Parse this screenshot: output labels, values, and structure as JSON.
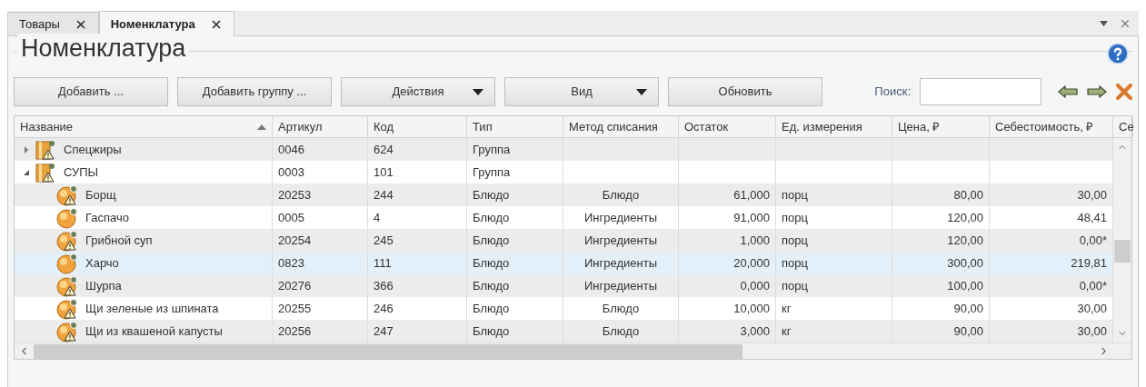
{
  "tabs": [
    {
      "label": "Товары",
      "selected": false
    },
    {
      "label": "Номенклатура",
      "selected": true
    }
  ],
  "panel": {
    "title": "Номенклатура"
  },
  "toolbar": {
    "buttons": [
      {
        "label": "Добавить ...",
        "kind": "plain"
      },
      {
        "label": "Добавить группу ...",
        "kind": "plain"
      },
      {
        "label": "Действия",
        "kind": "dropdown"
      },
      {
        "label": "Вид",
        "kind": "dropdown"
      },
      {
        "label": "Обновить",
        "kind": "plain"
      }
    ],
    "search_label": "Поиск:"
  },
  "table": {
    "columns": [
      {
        "label": "Название",
        "kind": "tree",
        "sorted": true
      },
      {
        "label": "Артикул",
        "kind": "text",
        "sorted": false
      },
      {
        "label": "Код",
        "kind": "text",
        "sorted": false
      },
      {
        "label": "Тип",
        "kind": "text",
        "sorted": false
      },
      {
        "label": "Метод списания",
        "kind": "centered",
        "sorted": false
      },
      {
        "label": "Остаток",
        "kind": "number",
        "sorted": false
      },
      {
        "label": "Ед. измерения",
        "kind": "text",
        "sorted": false
      },
      {
        "label": "Цена, ₽",
        "kind": "number",
        "sorted": false
      },
      {
        "label": "Себестоимость, ₽",
        "kind": "number",
        "sorted": false
      },
      {
        "label": "Се",
        "sorted": false
      }
    ],
    "rows": [
      {
        "kind": "group",
        "warning": true,
        "expanded": false,
        "selected": false,
        "cells": [
          "Спецжиры",
          "0046",
          "624",
          "Группа",
          "",
          "",
          "",
          "",
          ""
        ]
      },
      {
        "kind": "group",
        "warning": true,
        "expanded": true,
        "selected": false,
        "cells": [
          "СУПЫ",
          "0003",
          "101",
          "Группа",
          "",
          "",
          "",
          "",
          ""
        ],
        "children": [
          {
            "kind": "dish",
            "warning": true,
            "selected": false,
            "cells": [
              "Борщ",
              "20253",
              "244",
              "Блюдо",
              "Блюдо",
              "61,000",
              "порц",
              "80,00",
              "30,00"
            ]
          },
          {
            "kind": "dish",
            "warning": false,
            "selected": false,
            "cells": [
              "Гаспачо",
              "0005",
              "4",
              "Блюдо",
              "Ингредиенты",
              "91,000",
              "порц",
              "120,00",
              "48,41"
            ]
          },
          {
            "kind": "dish",
            "warning": true,
            "selected": false,
            "cells": [
              "Грибной суп",
              "20254",
              "245",
              "Блюдо",
              "Ингредиенты",
              "1,000",
              "порц",
              "120,00",
              "0,00*"
            ]
          },
          {
            "kind": "dish",
            "warning": false,
            "selected": true,
            "cells": [
              "Харчо",
              "0823",
              "111",
              "Блюдо",
              "Ингредиенты",
              "20,000",
              "порц",
              "300,00",
              "219,81"
            ]
          },
          {
            "kind": "dish",
            "warning": true,
            "selected": false,
            "cells": [
              "Шурпа",
              "20276",
              "366",
              "Блюдо",
              "Ингредиенты",
              "0,000",
              "порц",
              "100,00",
              "0,00*"
            ]
          },
          {
            "kind": "dish",
            "warning": true,
            "selected": false,
            "cells": [
              "Щи зеленые из шпината",
              "20255",
              "246",
              "Блюдо",
              "Блюдо",
              "10,000",
              "кг",
              "90,00",
              "30,00"
            ]
          },
          {
            "kind": "dish",
            "warning": true,
            "selected": false,
            "cells": [
              "Щи из квашеной капусты",
              "20256",
              "247",
              "Блюдо",
              "Блюдо",
              "3,000",
              "кг",
              "90,00",
              "30,00"
            ]
          }
        ]
      }
    ]
  }
}
